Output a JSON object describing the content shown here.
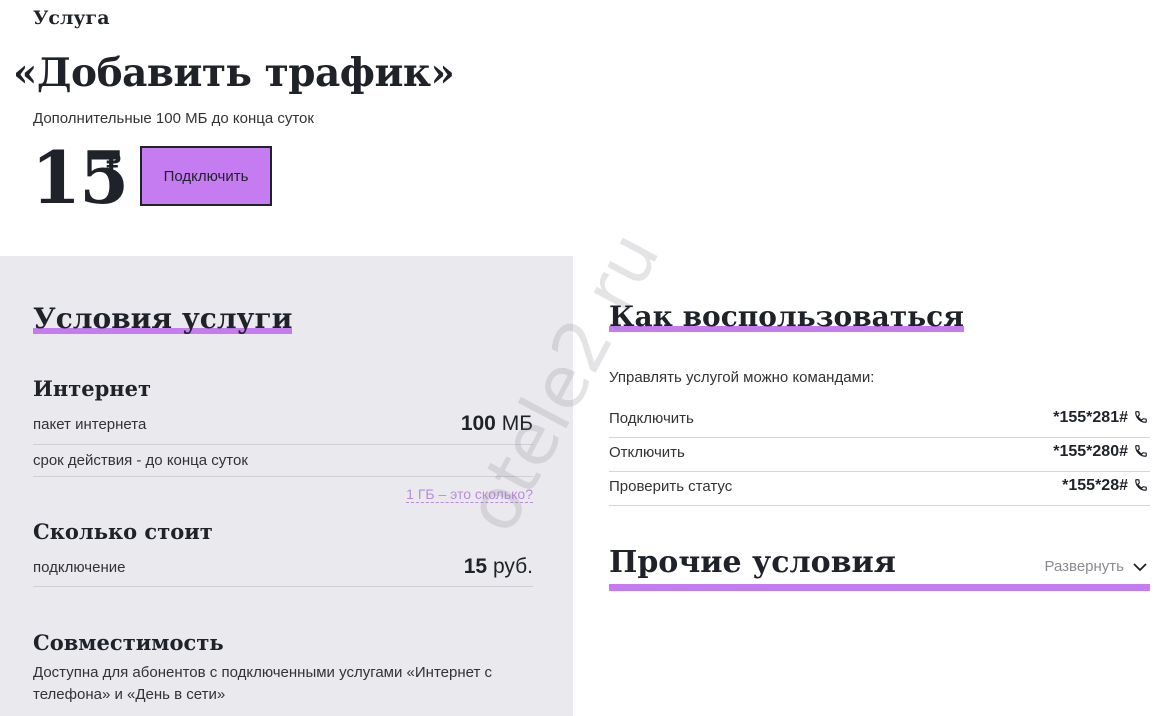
{
  "header": {
    "kicker": "Услуга",
    "title": "«Добавить трафик»",
    "subtitle": "Дополнительные 100 МБ до конца суток",
    "price": "15",
    "currency": "₽",
    "connect_label": "Подключить"
  },
  "conditions": {
    "title": "Условия услуги",
    "internet": {
      "heading": "Интернет",
      "rows": [
        {
          "label": "пакет интернета",
          "value_num": "100",
          "value_unit": "МБ"
        },
        {
          "label": "срок действия - до конца суток",
          "value_num": "",
          "value_unit": ""
        }
      ],
      "gb_link": "1 ГБ – это сколько?"
    },
    "cost": {
      "heading": "Сколько стоит",
      "rows": [
        {
          "label": "подключение",
          "value_num": "15",
          "value_unit": "руб."
        }
      ]
    },
    "compat": {
      "heading": "Совместимость",
      "text": "Доступна для абонентов с подключенными услугами «Интернет с телефона» и «День в сети»"
    }
  },
  "usage": {
    "title": "Как воспользоваться",
    "intro": "Управлять услугой можно командами:",
    "commands": [
      {
        "label": "Подключить",
        "code": "*155*281#"
      },
      {
        "label": "Отключить",
        "code": "*155*280#"
      },
      {
        "label": "Проверить статус",
        "code": "*155*28#"
      }
    ],
    "phone_icon": "phone-icon"
  },
  "other": {
    "title": "Прочие условия",
    "expand_label": "Развернуть",
    "chevron_icon": "chevron-down-icon"
  },
  "watermark": "otele2.ru",
  "colors": {
    "accent": "#c57cf0",
    "text": "#1f2229",
    "panel_bg": "#e9e9ee",
    "link": "#b98be0"
  }
}
